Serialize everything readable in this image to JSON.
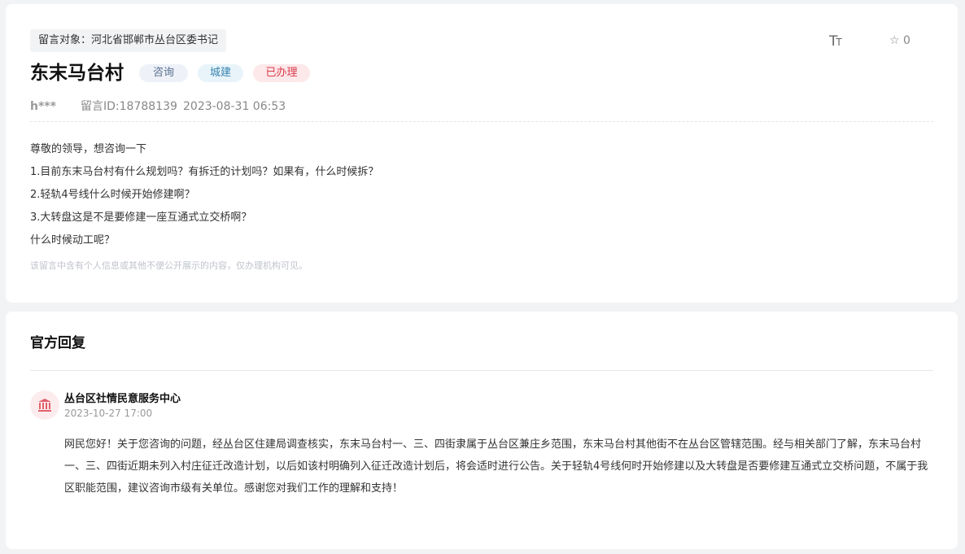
{
  "message": {
    "target_label": "留言对象：河北省邯郸市丛台区委书记",
    "title": "东末马台村",
    "tags": [
      "咨询",
      "城建",
      "已办理"
    ],
    "font_toggle_big": "T",
    "font_toggle_small": "T",
    "favorite_icon": "☆",
    "favorite_count": "0",
    "user": "h***",
    "message_id": "留言ID:18788139",
    "date": "2023-08-31 06:53",
    "body": [
      "尊敬的领导，想咨询一下",
      "1.目前东末马台村有什么规划吗？有拆迁的计划吗？如果有，什么时候拆？",
      "2.轻轨4号线什么时候开始修建啊？",
      "3.大转盘这是不是要修建一座互通式立交桥啊？",
      "什么时候动工呢？"
    ],
    "privacy_note": "该留言中含有个人信息或其他不便公开展示的内容，仅办理机构可见。"
  },
  "reply": {
    "section_title": "官方回复",
    "org_icon": "government-building-icon",
    "org_name": "丛台区社情民意服务中心",
    "date": "2023-10-27 17:00",
    "text": "网民您好！关于您咨询的问题，经丛台区住建局调查核实，东末马台村一、三、四街隶属于丛台区兼庄乡范围，东末马台村其他街不在丛台区管辖范围。经与相关部门了解，东末马台村一、三、四街近期未列入村庄征迁改造计划，以后如该村明确列入征迁改造计划后，将会适时进行公告。关于轻轨4号线何时开始修建以及大转盘是否要修建互通式立交桥问题，不属于我区职能范围，建议咨询市级有关单位。感谢您对我们工作的理解和支持！"
  },
  "colors": {
    "tag_consult": "#5a6f90",
    "tag_city": "#3a84b0",
    "tag_done": "#d93a4a",
    "org_icon": "#e0606a"
  }
}
